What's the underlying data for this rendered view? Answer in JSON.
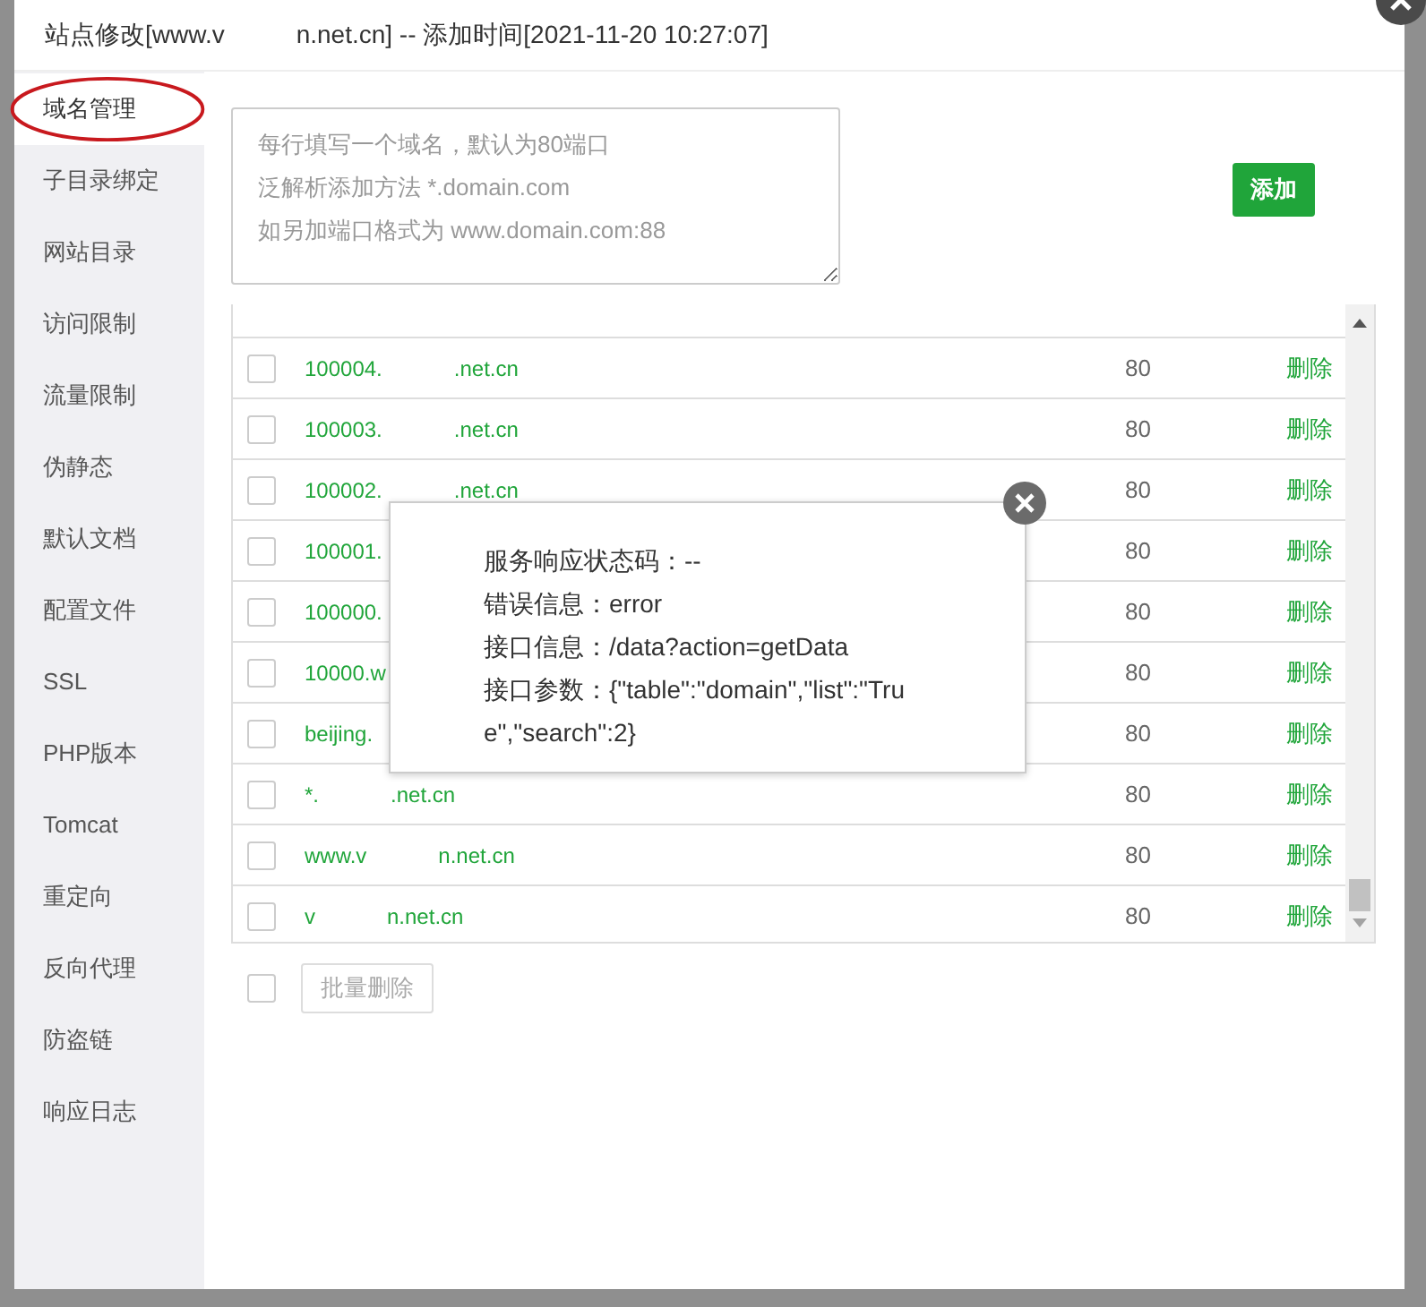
{
  "dialog": {
    "title_parts": [
      "站点修改[www.v",
      "n.net.cn] -- 添加时间[2021-11-20 10:27:07]"
    ]
  },
  "sidebar": {
    "items": [
      {
        "label": "域名管理",
        "selected": true,
        "circled": true
      },
      {
        "label": "子目录绑定",
        "selected": false,
        "circled": false
      },
      {
        "label": "网站目录",
        "selected": false,
        "circled": false
      },
      {
        "label": "访问限制",
        "selected": false,
        "circled": false
      },
      {
        "label": "流量限制",
        "selected": false,
        "circled": false
      },
      {
        "label": "伪静态",
        "selected": false,
        "circled": false
      },
      {
        "label": "默认文档",
        "selected": false,
        "circled": false
      },
      {
        "label": "配置文件",
        "selected": false,
        "circled": false
      },
      {
        "label": "SSL",
        "selected": false,
        "circled": false
      },
      {
        "label": "PHP版本",
        "selected": false,
        "circled": false
      },
      {
        "label": "Tomcat",
        "selected": false,
        "circled": false
      },
      {
        "label": "重定向",
        "selected": false,
        "circled": false
      },
      {
        "label": "反向代理",
        "selected": false,
        "circled": false
      },
      {
        "label": "防盗链",
        "selected": false,
        "circled": false
      },
      {
        "label": "响应日志",
        "selected": false,
        "circled": false
      }
    ]
  },
  "domain_input": {
    "placeholder": [
      "每行填写一个域名，默认为80端口",
      "泛解析添加方法 *.domain.com",
      "如另加端口格式为 www.domain.com:88"
    ]
  },
  "add_button": "添加",
  "domains": [
    {
      "name_parts": [
        "100004.",
        ".net.cn"
      ],
      "port": "80",
      "action": "删除",
      "checked": false
    },
    {
      "name_parts": [
        "100003.",
        ".net.cn"
      ],
      "port": "80",
      "action": "删除",
      "checked": false
    },
    {
      "name_parts": [
        "100002.",
        ".net.cn"
      ],
      "port": "80",
      "action": "删除",
      "checked": false
    },
    {
      "name_parts": [
        "100001."
      ],
      "port": "80",
      "action": "删除",
      "checked": false
    },
    {
      "name_parts": [
        "100000."
      ],
      "port": "80",
      "action": "删除",
      "checked": false
    },
    {
      "name_parts": [
        "10000.w"
      ],
      "port": "80",
      "action": "删除",
      "checked": false
    },
    {
      "name_parts": [
        "beijing."
      ],
      "port": "80",
      "action": "删除",
      "checked": false
    },
    {
      "name_parts": [
        "*.",
        ".net.cn"
      ],
      "port": "80",
      "action": "删除",
      "checked": false
    },
    {
      "name_parts": [
        "www.v",
        "n.net.cn"
      ],
      "port": "80",
      "action": "删除",
      "checked": false
    },
    {
      "name_parts": [
        "v",
        "n.net.cn"
      ],
      "port": "80",
      "action": "删除",
      "checked": false
    }
  ],
  "select_all": {
    "checked": false
  },
  "bulk_delete": {
    "label": "批量删除",
    "disabled": true
  },
  "error_popup": {
    "lines": [
      "服务响应状态码：--",
      "错误信息：error",
      "接口信息：/data?action=getData",
      "接口参数：{\"table\":\"domain\",\"list\":\"True\",\"search\":2}"
    ]
  }
}
